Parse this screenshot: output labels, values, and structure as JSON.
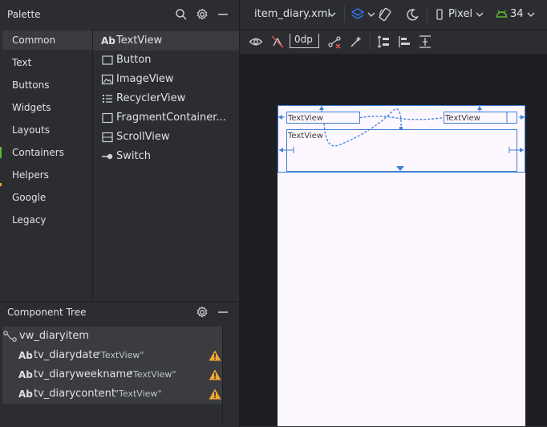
{
  "palette": {
    "title": "Palette",
    "categories": [
      "Common",
      "Text",
      "Buttons",
      "Widgets",
      "Layouts",
      "Containers",
      "Helpers",
      "Google",
      "Legacy"
    ],
    "selected_category": "Common",
    "items": [
      {
        "label": "TextView",
        "icon": "textview-icon",
        "icon_text": "Ab"
      },
      {
        "label": "Button",
        "icon": "button-icon"
      },
      {
        "label": "ImageView",
        "icon": "imageview-icon"
      },
      {
        "label": "RecyclerView",
        "icon": "recyclerview-icon"
      },
      {
        "label": "FragmentContainer...",
        "icon": "fragmentcontainer-icon"
      },
      {
        "label": "ScrollView",
        "icon": "scrollview-icon"
      },
      {
        "label": "Switch",
        "icon": "switch-icon"
      }
    ]
  },
  "component_tree": {
    "title": "Component Tree",
    "root": "vw_diaryitem",
    "children": [
      {
        "prefix": "Ab",
        "id": "tv_diarydate",
        "type": "\"TextView\""
      },
      {
        "prefix": "Ab",
        "id": "tv_diaryweekname",
        "type": "\"TextView\""
      },
      {
        "prefix": "Ab",
        "id": "tv_diarycontent",
        "type": "\"TextView\""
      }
    ]
  },
  "toolbar": {
    "file_name": "item_diary.xml",
    "device": "Pixel",
    "api_level": "34",
    "margin_value": "0dp"
  },
  "design": {
    "textview_label": "TextView"
  },
  "colors": {
    "accent": "#3574f0",
    "blueprint": "#3f7fd6",
    "warning": "#f0a732",
    "android_green": "#5fb832",
    "panel": "#2b2d30",
    "canvas": "#1e1f22",
    "device": "#fdf7ff"
  }
}
